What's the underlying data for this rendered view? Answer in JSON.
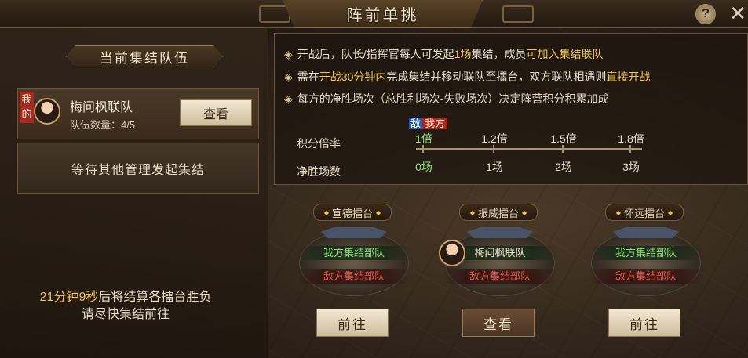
{
  "window": {
    "title": "阵前单挑",
    "help_label": "?",
    "close_label": "✕"
  },
  "left_panel": {
    "section_title": "当前集结队伍",
    "team": {
      "mine_tag": "我的",
      "name": "梅问枫联队",
      "count_label": "队伍数量：4/5",
      "view_button": "查看"
    },
    "waiting_text": "等待其他管理发起集结",
    "timer_highlight": "21分钟9秒",
    "timer_rest": "后将结算各擂台胜负",
    "timer_line2": "请尽快集结前往"
  },
  "rules": {
    "line1": {
      "a": "开战后，队长/指挥官每人可发起",
      "b": "1场",
      "c": "集结，成员",
      "d": "可加入集结联队"
    },
    "line2": {
      "a": "需在",
      "b": "开战30分钟内",
      "c": "完成集结并移动联队至擂台，双方联队相遇则",
      "d": "直接开战"
    },
    "line3": "每方的净胜场次（总胜利场次-失败场次）决定阵营积分积累加成"
  },
  "scale": {
    "tag_enemy": "敌",
    "tag_mine": "我方",
    "row1_label": "积分倍率",
    "row2_label": "净胜场数",
    "multipliers": [
      "1倍",
      "1.2倍",
      "1.5倍",
      "1.8倍"
    ],
    "wins": [
      "0场",
      "1场",
      "2场",
      "3场"
    ]
  },
  "arenas": [
    {
      "name": "宣德擂台",
      "ally": "我方集结部队",
      "enemy": "敌方集结部队",
      "button": "前往"
    },
    {
      "name": "振威擂台",
      "ally": "梅问枫联队",
      "enemy": "敌方集结部队",
      "button": "查看"
    },
    {
      "name": "怀远擂台",
      "ally": "我方集结部队",
      "enemy": "敌方集结部队",
      "button": "前往"
    }
  ],
  "colors": {
    "highlight_yellow": "#f2c846",
    "ally_green": "#8fe07a",
    "enemy_red": "#e0564a"
  }
}
